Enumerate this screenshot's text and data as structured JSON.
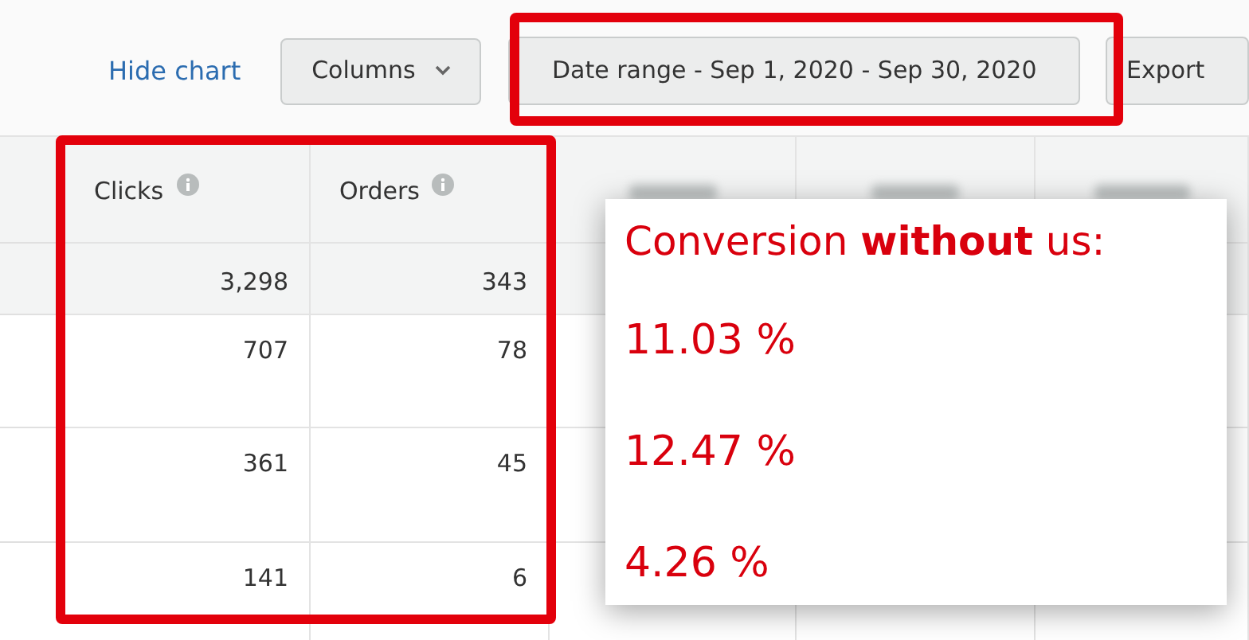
{
  "toolbar": {
    "hide_chart_link": "Hide chart",
    "columns_button": "Columns",
    "date_range_button": "Date range - Sep 1, 2020 - Sep 30, 2020",
    "export_button": "Export"
  },
  "table": {
    "columns": [
      {
        "label": "Clicks",
        "info": true
      },
      {
        "label": "Orders",
        "info": true
      }
    ],
    "total_row": [
      "3,298",
      "343"
    ],
    "rows": [
      [
        "707",
        "78"
      ],
      [
        "361",
        "45"
      ],
      [
        "141",
        "6"
      ]
    ]
  },
  "annotation": {
    "title": "Conversion **without** us:",
    "values": [
      "11.03 %",
      "12.47 %",
      "4.26 %"
    ]
  }
}
